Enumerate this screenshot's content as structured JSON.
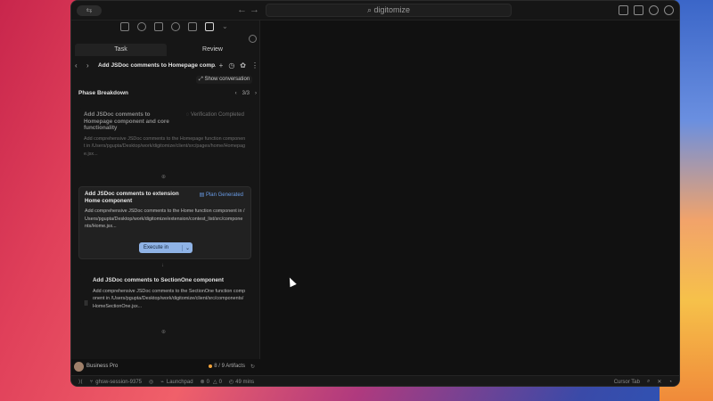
{
  "search": {
    "text": "digitomize"
  },
  "tabs": [
    {
      "label": "Task"
    },
    {
      "label": "Review"
    }
  ],
  "header": {
    "title": "Add JSDoc comments to Homepage comp..."
  },
  "show_conversation": "Show conversation",
  "phase": {
    "title": "Phase Breakdown",
    "pager": "3/3"
  },
  "cards": [
    {
      "title": "Add JSDoc comments to Homepage component and core functionality",
      "status": "Verification Completed",
      "desc": "Add comprehensive JSDoc comments to the Homepage function component in /Users/pgupta/Desktop/work/digitomize/client/src/pages/home/Homepage.jsx..."
    },
    {
      "title": "Add JSDoc comments to extension Home component",
      "status": "Plan Generated",
      "desc": "Add comprehensive JSDoc comments to the Home function component in /Users/pgupta/Desktop/work/digitomize/extension/contest_list/src/components/Home.jsx...",
      "execute": "Execute in"
    },
    {
      "title": "Add JSDoc comments to SectionOne component",
      "desc": "Add comprehensive JSDoc comments to the SectionOne function component in /Users/pgupta/Desktop/work/digitomize/client/src/components/HomeSectionOne.jsx..."
    }
  ],
  "bottom": {
    "plan": "Business Pro",
    "artifacts": "8 / 9 Artifacts"
  },
  "status": {
    "session": "ghsw-session-9375",
    "launchpad": "Launchpad",
    "errors": "0",
    "warnings": "0",
    "time": "49 mins",
    "cursor_tab": "Cursor Tab"
  },
  "colors": {
    "accent": "#6a9de8",
    "execute_button": "#8fb3e6",
    "artifacts_dot": "#f2a33a"
  }
}
